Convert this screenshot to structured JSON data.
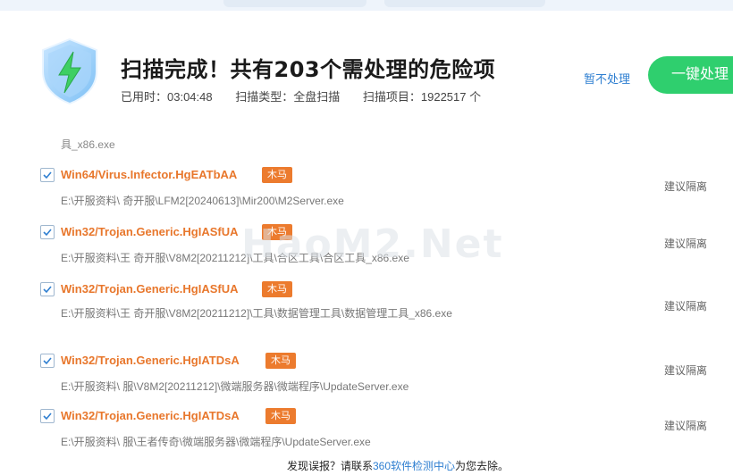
{
  "header": {
    "title": "扫描完成！共有203个需处理的危险项",
    "elapsed": "已用时：03:04:48",
    "scan_type": "扫描类型：全盘扫描",
    "scan_items": "扫描项目：1922517 个",
    "skip_label": "暂不处理",
    "fix_label": "一键处理"
  },
  "colors": {
    "accent_green": "#2fcf6e",
    "threat_orange": "#e8772c",
    "link_blue": "#2f7fd1"
  },
  "list": {
    "partial_text": "具_x86.exe",
    "items": [
      {
        "name": "Win64/Virus.Infector.HgEATbAA",
        "badge": "木马",
        "path": "E:\\开服资料\\     奇开服\\LFM2[20240613]\\Mir200\\M2Server.exe",
        "action": "建议隔离",
        "checked": true
      },
      {
        "name": "Win32/Trojan.Generic.HgIASfUA",
        "badge": "木马",
        "path": "E:\\开服资料\\王     奇开服\\V8M2[20211212]\\工具\\合区工具\\合区工具_x86.exe",
        "action": "建议隔离",
        "checked": true
      },
      {
        "name": "Win32/Trojan.Generic.HgIASfUA",
        "badge": "木马",
        "path": "E:\\开服资料\\王     奇开服\\V8M2[20211212]\\工具\\数据管理工具\\数据管理工具_x86.exe",
        "action": "建议隔离",
        "checked": true
      },
      {
        "name": "Win32/Trojan.Generic.HgIATDsA",
        "badge": "木马",
        "path": "E:\\开服资料\\        服\\V8M2[20211212]\\微端服务器\\微端程序\\UpdateServer.exe",
        "action": "建议隔离",
        "checked": true
      },
      {
        "name": "Win32/Trojan.Generic.HgIATDsA",
        "badge": "木马",
        "path": "E:\\开服资料\\        服\\王者传奇\\微端服务器\\微端程序\\UpdateServer.exe",
        "action": "建议隔离",
        "checked": true
      }
    ]
  },
  "watermark": "HaoM2.Net",
  "footer": {
    "prefix": "发现误报？请联系",
    "link": "360软件检测中心",
    "suffix": "为您去除。"
  },
  "icons": {
    "shield": "shield-lightning-icon",
    "check": "check-icon"
  }
}
